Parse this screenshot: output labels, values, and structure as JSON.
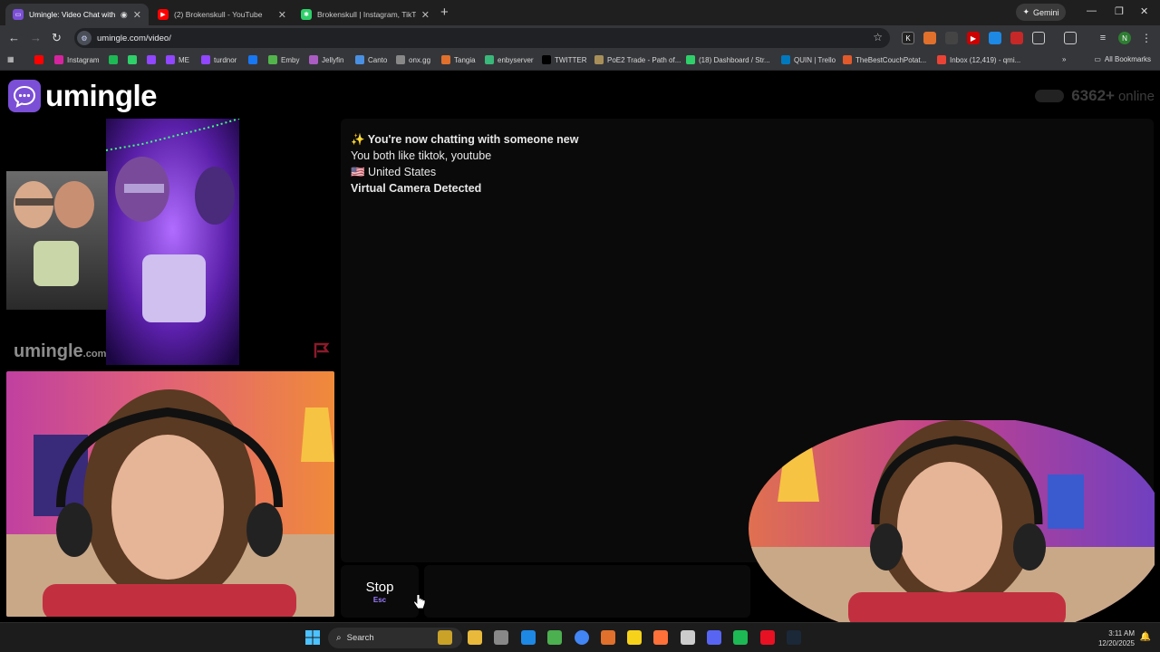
{
  "browser": {
    "tabs": [
      {
        "title": "Umingle: Video Chat with S",
        "active": true,
        "favicon_color": "#7b4fd6"
      },
      {
        "title": "(2) Brokenskull - YouTube",
        "active": false,
        "favicon_color": "#ff0000"
      },
      {
        "title": "Brokenskull | Instagram, TikTok",
        "active": false,
        "favicon_color": "#2fcf6a"
      }
    ],
    "gemini_label": "Gemini",
    "url": "umingle.com/video/",
    "bookmarks": [
      {
        "label": "",
        "color": "#ff0000"
      },
      {
        "label": "Instagram",
        "color": "#d6249f"
      },
      {
        "label": "",
        "color": "#1db954"
      },
      {
        "label": "",
        "color": "#2fcf6a"
      },
      {
        "label": "",
        "color": "#9146ff"
      },
      {
        "label": "ME",
        "color": "#9146ff"
      },
      {
        "label": "turdnor",
        "color": "#9146ff"
      },
      {
        "label": "",
        "color": "#1877f2"
      },
      {
        "label": "Emby",
        "color": "#52b54b"
      },
      {
        "label": "Jellyfin",
        "color": "#aa5cc3"
      },
      {
        "label": "Canto",
        "color": "#4a90e2"
      },
      {
        "label": "onx.gg",
        "color": "#888888"
      },
      {
        "label": "Tangia",
        "color": "#e0702c"
      },
      {
        "label": "enbyserver",
        "color": "#3ab77a"
      },
      {
        "label": "TWITTER",
        "color": "#000000"
      },
      {
        "label": "PoE2 Trade - Path of...",
        "color": "#a88f5a"
      },
      {
        "label": "(18) Dashboard / Str...",
        "color": "#2fcf6a"
      },
      {
        "label": "QUIN | Trello",
        "color": "#0079bf"
      },
      {
        "label": "TheBestCouchPotat...",
        "color": "#e05a2b"
      },
      {
        "label": "Inbox (12,419) - qmi...",
        "color": "#ea4335"
      }
    ],
    "all_bookmarks_label": "All Bookmarks"
  },
  "site": {
    "logo_text": "umingle",
    "online_count": "6362+",
    "online_label": "online",
    "watermark": "umingle",
    "watermark_suffix": ".com",
    "brand_color": "#7b4fd6"
  },
  "chat": {
    "messages": [
      {
        "text": "✨ You're now chatting with someone new",
        "bold": true
      },
      {
        "text": "You both like tiktok, youtube",
        "bold": false
      },
      {
        "text": "🇺🇸 United States",
        "bold": false
      },
      {
        "text": "Virtual Camera Detected",
        "bold": true
      }
    ],
    "stop_label": "Stop",
    "stop_shortcut": "Esc",
    "input_placeholder": ""
  },
  "taskbar": {
    "search_label": "Search",
    "time": "3:11 AM",
    "date": "12/20/2025",
    "app_colors": [
      "#c9a227",
      "#e8b93a",
      "#888888",
      "#1e88e5",
      "#4caf50",
      "#4285f4",
      "#e0702c",
      "#f7d21b",
      "#ff7139",
      "#cccccc",
      "#5865f2",
      "#1db954",
      "#e81123",
      "#1b2838"
    ]
  }
}
